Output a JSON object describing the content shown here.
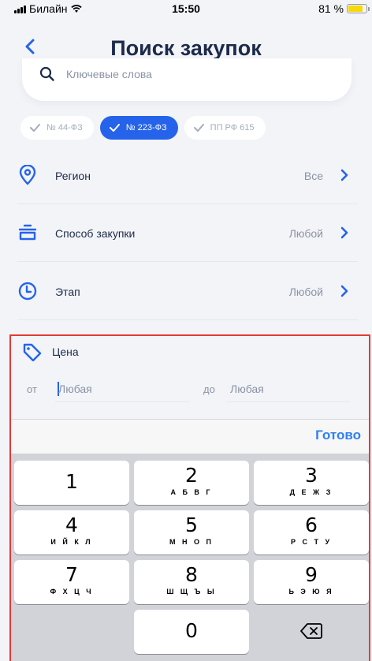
{
  "status_bar": {
    "carrier": "Билайн",
    "time": "15:50",
    "battery": "81 %",
    "battery_level": 0.81
  },
  "header": {
    "title": "Поиск закупок",
    "back_icon": "chevron-left-icon"
  },
  "search": {
    "placeholder": "Ключевые слова",
    "value": ""
  },
  "chips": [
    {
      "label": "№ 44-ФЗ",
      "active": false
    },
    {
      "label": "№ 223-ФЗ",
      "active": true
    },
    {
      "label": "ПП РФ 615",
      "active": false
    }
  ],
  "filters": [
    {
      "label": "Регион",
      "value": "Все",
      "icon": "location-pin-icon"
    },
    {
      "label": "Способ закупки",
      "value": "Любой",
      "icon": "stack-icon"
    },
    {
      "label": "Этап",
      "value": "Любой",
      "icon": "clock-icon"
    }
  ],
  "price": {
    "label": "Цена",
    "from_label": "от",
    "from_placeholder": "Любая",
    "to_label": "до",
    "to_placeholder": "Любая"
  },
  "keyboard": {
    "done_label": "Готово",
    "keys": [
      {
        "num": "1",
        "letters": ""
      },
      {
        "num": "2",
        "letters": "А Б В Г"
      },
      {
        "num": "3",
        "letters": "Д Е Ж З"
      },
      {
        "num": "4",
        "letters": "И Й К Л"
      },
      {
        "num": "5",
        "letters": "М Н О П"
      },
      {
        "num": "6",
        "letters": "Р С Т У"
      },
      {
        "num": "7",
        "letters": "Ф Х Ц Ч"
      },
      {
        "num": "8",
        "letters": "Ш Щ Ъ Ы"
      },
      {
        "num": "9",
        "letters": "Ь Э Ю Я"
      },
      {
        "num": "0",
        "letters": ""
      }
    ]
  },
  "colors": {
    "accent": "#2563eb",
    "background": "#f3f4f8",
    "highlight_border": "#e53935"
  }
}
